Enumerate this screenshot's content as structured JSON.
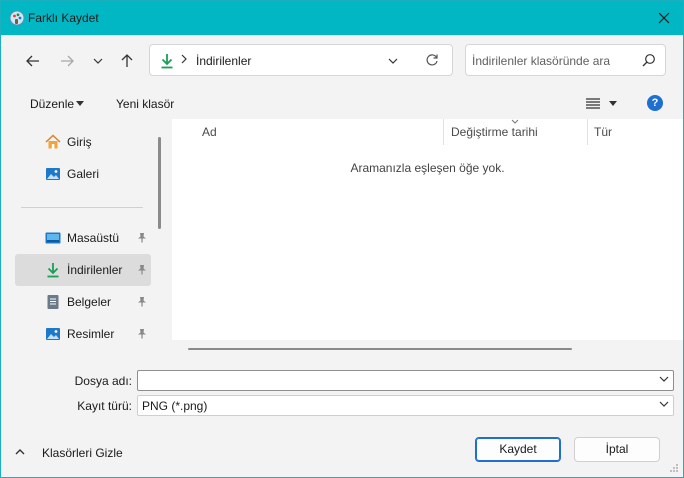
{
  "window": {
    "title": "Farklı Kaydet"
  },
  "navigation": {
    "back_label": "←",
    "forward_label": "→",
    "up_label": "↑",
    "address_path": "İndirilenler",
    "search_placeholder": "İndirilenler klasöründe ara"
  },
  "commandbar": {
    "organize_label": "Düzenle",
    "new_folder_label": "Yeni klasör",
    "help_label": "?"
  },
  "sidebar": {
    "items": [
      {
        "label": "Giriş",
        "icon": "home-icon"
      },
      {
        "label": "Galeri",
        "icon": "gallery-icon"
      },
      {
        "label": "Masaüstü",
        "icon": "desktop-icon",
        "pinned": true
      },
      {
        "label": "İndirilenler",
        "icon": "download-icon",
        "pinned": true,
        "selected": true
      },
      {
        "label": "Belgeler",
        "icon": "documents-icon",
        "pinned": true
      },
      {
        "label": "Resimler",
        "icon": "pictures-icon",
        "pinned": true
      }
    ]
  },
  "filelist": {
    "columns": [
      "Ad",
      "Değiştirme tarihi",
      "Tür"
    ],
    "empty_message": "Aramanızla eşleşen öğe yok."
  },
  "form": {
    "filename_label": "Dosya adı:",
    "filename_value": "",
    "filetype_label": "Kayıt türü:",
    "filetype_value": "PNG (*.png)"
  },
  "footer": {
    "hide_folders_label": "Klasörleri Gizle",
    "save_label": "Kaydet",
    "cancel_label": "İptal"
  },
  "colors": {
    "titlebar": "#00b7c3",
    "accent": "#1e6fd0",
    "download_green": "#1a9e55"
  }
}
